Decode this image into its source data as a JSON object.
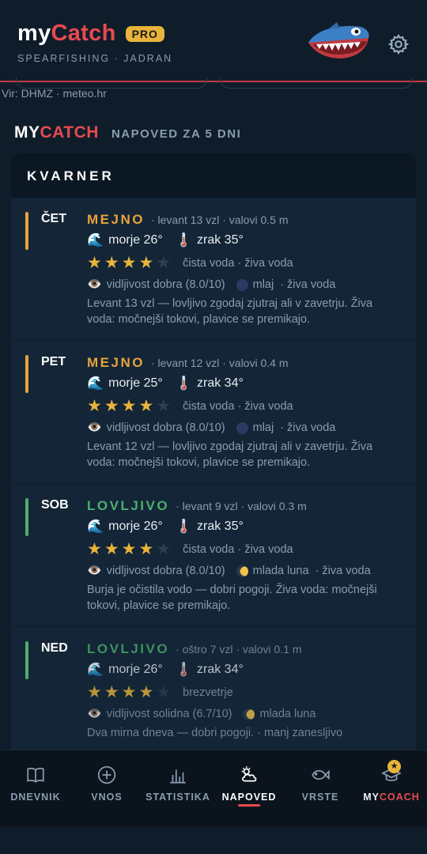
{
  "header": {
    "brand_my": "my",
    "brand_catch": "Catch",
    "badge": "PRO",
    "subtitle": "SPEARFISHING · JADRAN",
    "settings_icon": "gear-icon",
    "mascot_icon": "shark-mascot"
  },
  "source": {
    "text": "Vir: DHMZ · meteo.hr"
  },
  "section": {
    "my": "MY",
    "catch": "CATCH",
    "subtitle": "NAPOVED ZA 5 DNI"
  },
  "region": {
    "name": "KVARNER"
  },
  "colors": {
    "accent": "#e84a4f",
    "mejno": "#e9a23b",
    "lovljivo": "#4caf6e",
    "star": "#e9b43b"
  },
  "days": [
    {
      "label": "ČET",
      "rating": "MEJNO",
      "rating_color": "#e9a23b",
      "meta": "· levant 13 vzl · valovi 0.5 m",
      "sea": "morje 26°",
      "air": "zrak 35°",
      "stars": 4,
      "conditions": "čista voda · živa voda",
      "visibility": "vidljivost dobra (8.0/10)",
      "moon": "mlaj",
      "moon_extra": "·  živa voda",
      "desc": "Levant 13 vzl — lovljivo zgodaj zjutraj ali v zavetrju. Živa voda: močnejši tokovi, plavice se premikajo."
    },
    {
      "label": "PET",
      "rating": "MEJNO",
      "rating_color": "#e9a23b",
      "meta": "· levant 12 vzl · valovi 0.4 m",
      "sea": "morje 25°",
      "air": "zrak 34°",
      "stars": 4,
      "conditions": "čista voda · živa voda",
      "visibility": "vidljivost dobra (8.0/10)",
      "moon": "mlaj",
      "moon_extra": "·  živa voda",
      "desc": "Levant 12 vzl — lovljivo zgodaj zjutraj ali v zavetrju. Živa voda: močnejši tokovi, plavice se premikajo."
    },
    {
      "label": "SOB",
      "rating": "LOVLJIVO",
      "rating_color": "#4caf6e",
      "meta": "· levant 9 vzl · valovi 0.3 m",
      "sea": "morje 26°",
      "air": "zrak 35°",
      "stars": 4,
      "conditions": "čista voda · živa voda",
      "visibility": "vidljivost dobra (8.0/10)",
      "moon": "mlada luna",
      "moon_extra": "·  živa voda",
      "desc": "Burja je očistila vodo — dobri pogoji. Živa voda: močnejši tokovi, plavice se premikajo."
    },
    {
      "label": "NED",
      "rating": "LOVLJIVO",
      "rating_color": "#4caf6e",
      "meta": "· oštro 7 vzl · valovi 0.1 m",
      "sea": "morje 26°",
      "air": "zrak 34°",
      "stars": 4,
      "conditions": "brezvetrje",
      "visibility": "vidljivost solidna (6.7/10)",
      "moon": "mlada luna",
      "moon_extra": "",
      "desc": "Dva mirna dneva — dobri pogoji.  · manj zanesljivo"
    }
  ],
  "nav": {
    "items": [
      {
        "label": "DNEVNIK",
        "icon": "book-icon"
      },
      {
        "label": "VNOS",
        "icon": "plus-circle-icon"
      },
      {
        "label": "STATISTIKA",
        "icon": "bar-chart-icon"
      },
      {
        "label": "NAPOVED",
        "icon": "weather-icon"
      },
      {
        "label": "VRSTE",
        "icon": "fish-icon"
      }
    ],
    "coach_my": "MY",
    "coach_red": "COACH",
    "coach_icon": "graduation-cap-icon",
    "active": "NAPOVED"
  }
}
